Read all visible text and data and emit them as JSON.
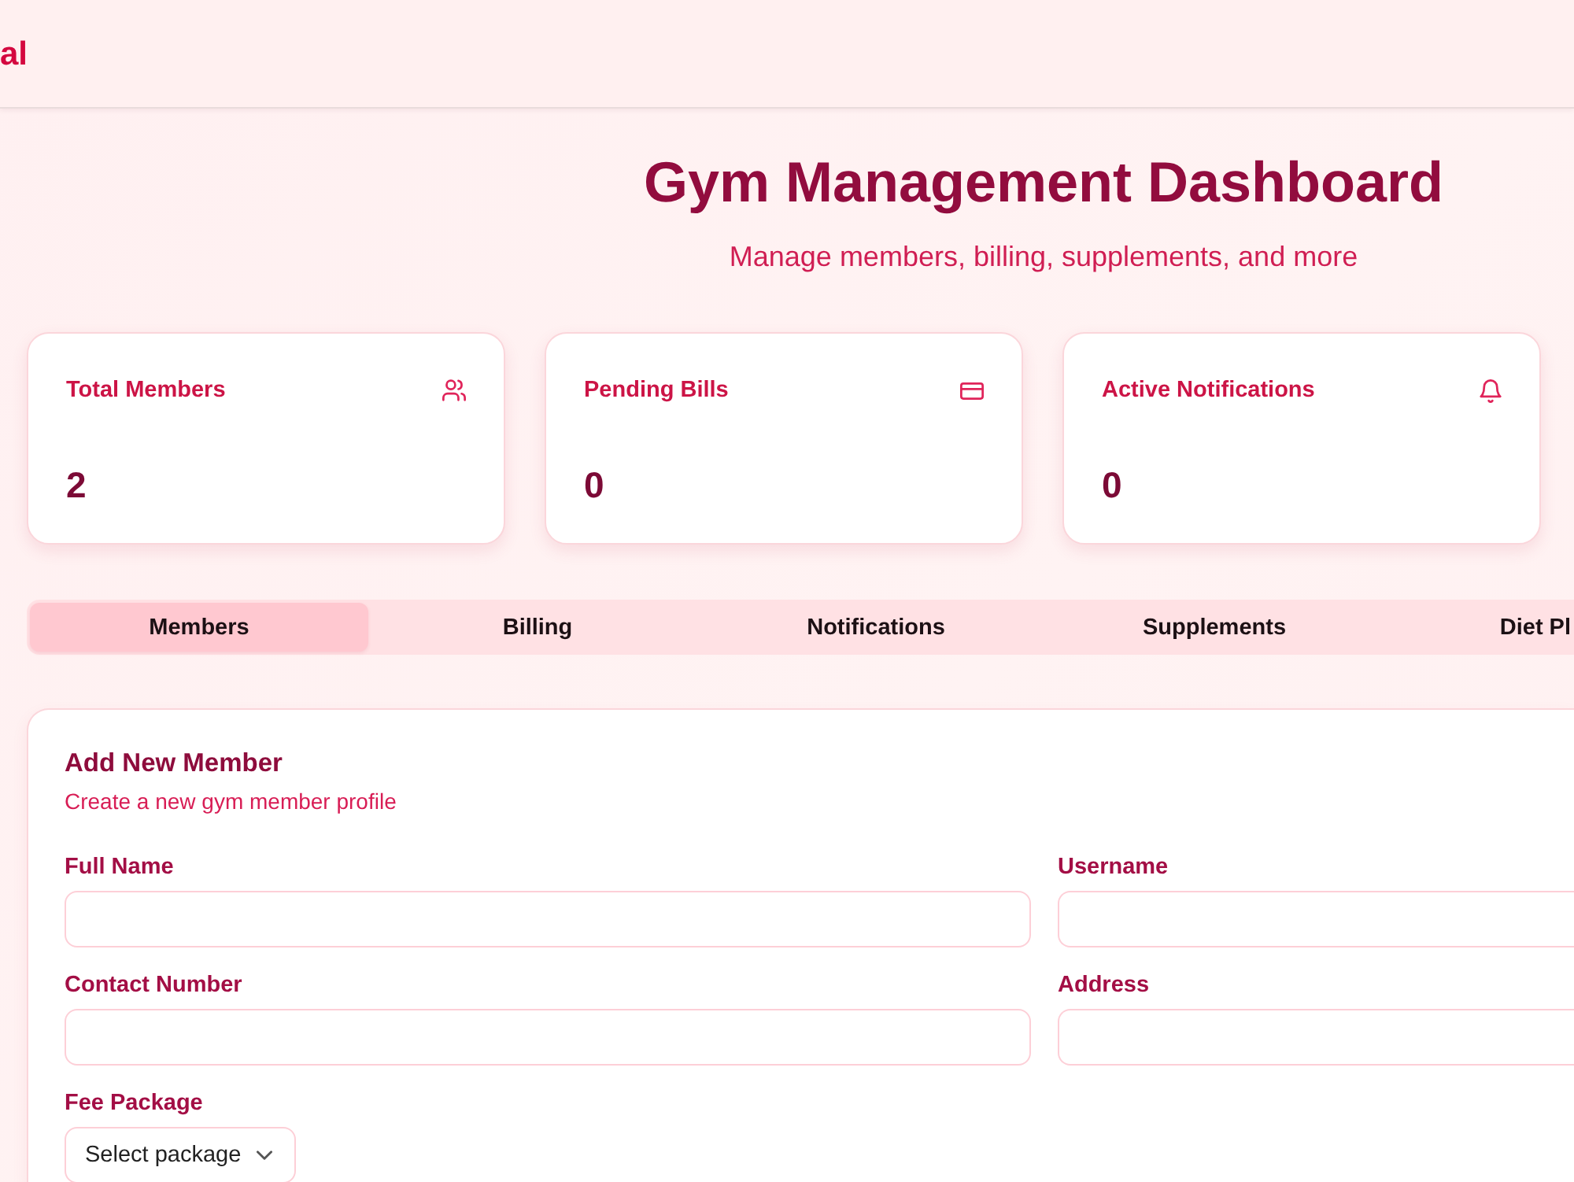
{
  "header": {
    "brand": "al"
  },
  "heading": {
    "title": "Gym Management Dashboard",
    "subtitle": "Manage members, billing, supplements, and more"
  },
  "stats": [
    {
      "label": "Total Members",
      "value": "2"
    },
    {
      "label": "Pending Bills",
      "value": "0"
    },
    {
      "label": "Active Notifications",
      "value": "0"
    }
  ],
  "tabs": [
    {
      "label": "Members",
      "selected": true
    },
    {
      "label": "Billing",
      "selected": false
    },
    {
      "label": "Notifications",
      "selected": false
    },
    {
      "label": "Supplements",
      "selected": false
    },
    {
      "label": "Diet Pl",
      "selected": false
    }
  ],
  "form": {
    "title": "Add New Member",
    "subtitle": "Create a new gym member profile",
    "fields": [
      {
        "label": "Full Name",
        "kind": "text"
      },
      {
        "label": "Username",
        "kind": "text"
      },
      {
        "label": "Contact Number",
        "kind": "text"
      },
      {
        "label": "Address",
        "kind": "text"
      },
      {
        "label": "Fee Package",
        "kind": "select",
        "placeholder": "Select package"
      }
    ]
  }
}
